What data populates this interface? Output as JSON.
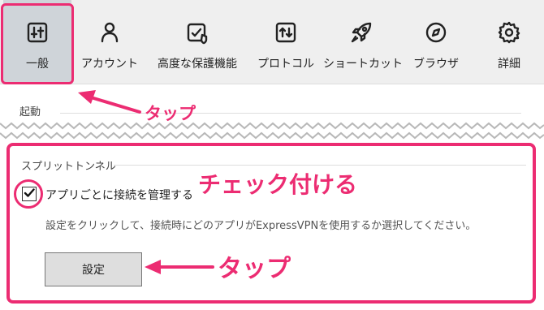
{
  "toolbar": {
    "tabs": [
      {
        "label": "一般",
        "icon": "sliders-icon",
        "active": true
      },
      {
        "label": "アカウント",
        "icon": "person-icon"
      },
      {
        "label": "高度な保護機能",
        "icon": "shield-check-icon"
      },
      {
        "label": "プロトコル",
        "icon": "protocol-arrows-icon"
      },
      {
        "label": "ショートカット",
        "icon": "rocket-icon"
      },
      {
        "label": "ブラウザ",
        "icon": "compass-icon"
      },
      {
        "label": "詳細",
        "icon": "gear-icon"
      }
    ]
  },
  "startup": {
    "title": "起動"
  },
  "split_tunnel": {
    "title": "スプリットトンネル",
    "checkbox_label": "アプリごとに接続を管理する",
    "checkbox_checked": true,
    "description": "設定をクリックして、接続時にどのアプリがExpressVPNを使用するか選択してください。",
    "settings_button": "設定"
  },
  "annotations": {
    "tap_tab": "タップ",
    "check": "チェック付ける",
    "tap_button": "タップ",
    "color": "#ec2c72"
  }
}
